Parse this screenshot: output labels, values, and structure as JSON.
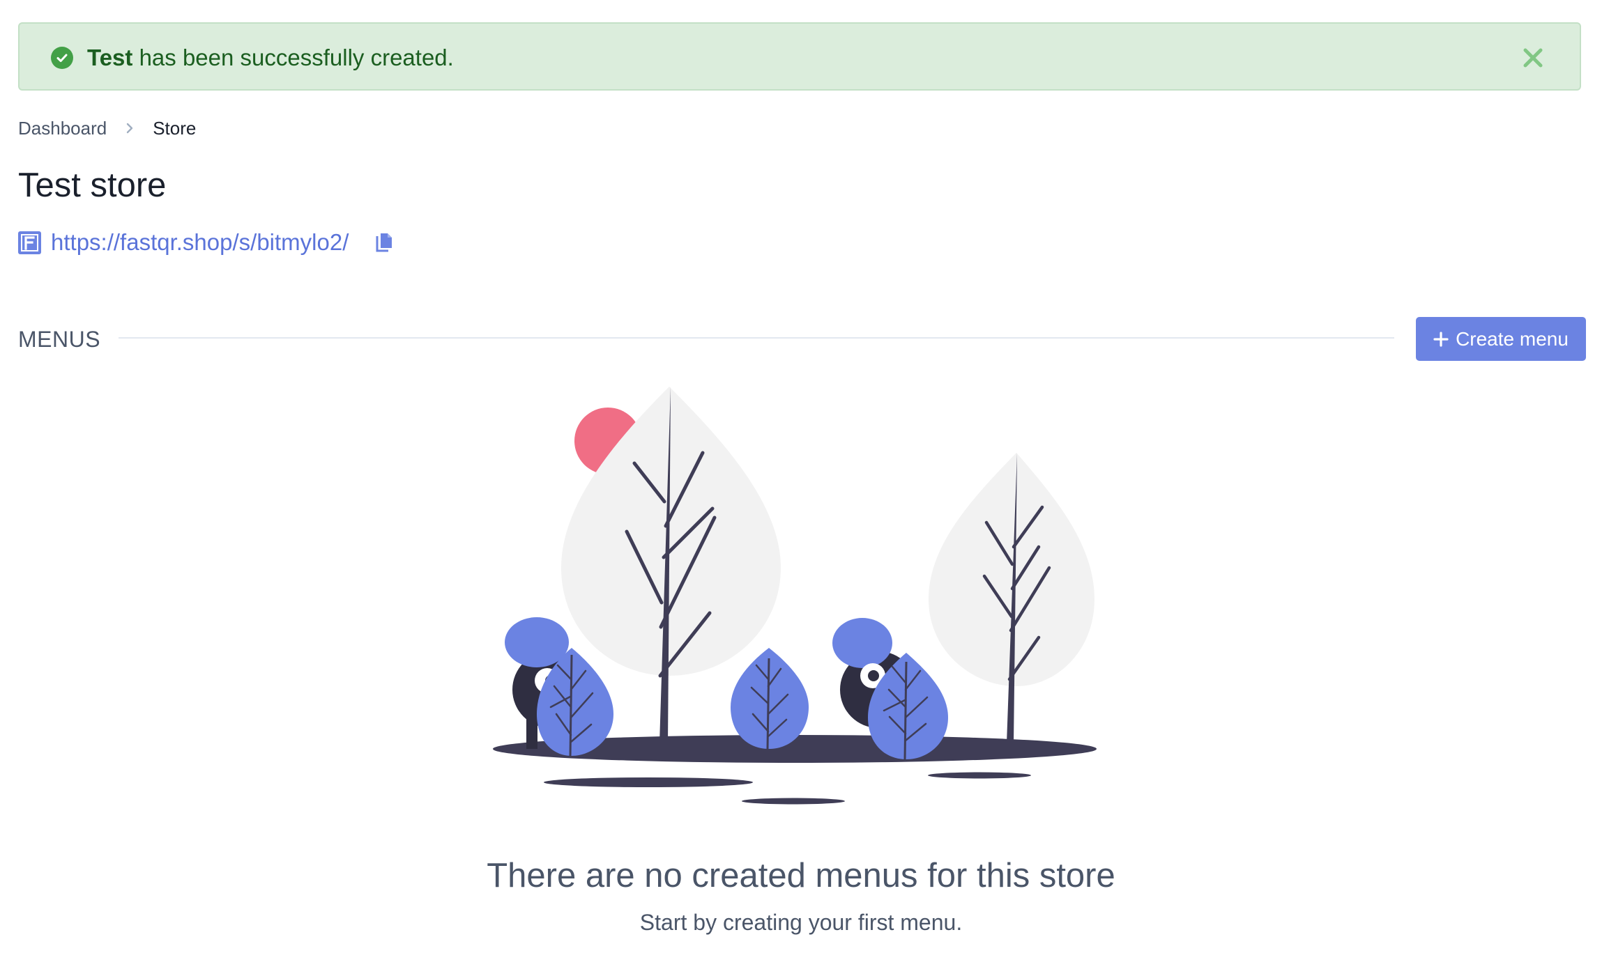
{
  "colors": {
    "alert_bg": "#dbeddc",
    "alert_text": "#1b5e20",
    "success_icon": "#43a047",
    "close_icon": "#81c784",
    "accent": "#6b83e2",
    "link": "#5a73d9",
    "tree_leaf": "#f2f2f2",
    "ground": "#3f3d56",
    "sun": "#f06e85"
  },
  "alert": {
    "icon": "check-circle-icon",
    "strong": "Test",
    "message": " has been successfully created.",
    "close_icon": "close-icon"
  },
  "breadcrumb": {
    "items": [
      {
        "label": "Dashboard"
      },
      {
        "label": "Store"
      }
    ],
    "separator_icon": "chevron-right-icon"
  },
  "store": {
    "title": "Test store",
    "brand_icon": "fastqr-logo-icon",
    "url": "https://fastqr.shop/s/bitmylo2/",
    "copy_icon": "copy-icon"
  },
  "menus": {
    "section_title": "MENUS",
    "create_button": {
      "icon": "plus-icon",
      "label": "Create menu"
    }
  },
  "empty_state": {
    "illustration": "empty-forest-illustration",
    "title": "There are no created menus for this store",
    "subtitle": "Start by creating your first menu."
  }
}
